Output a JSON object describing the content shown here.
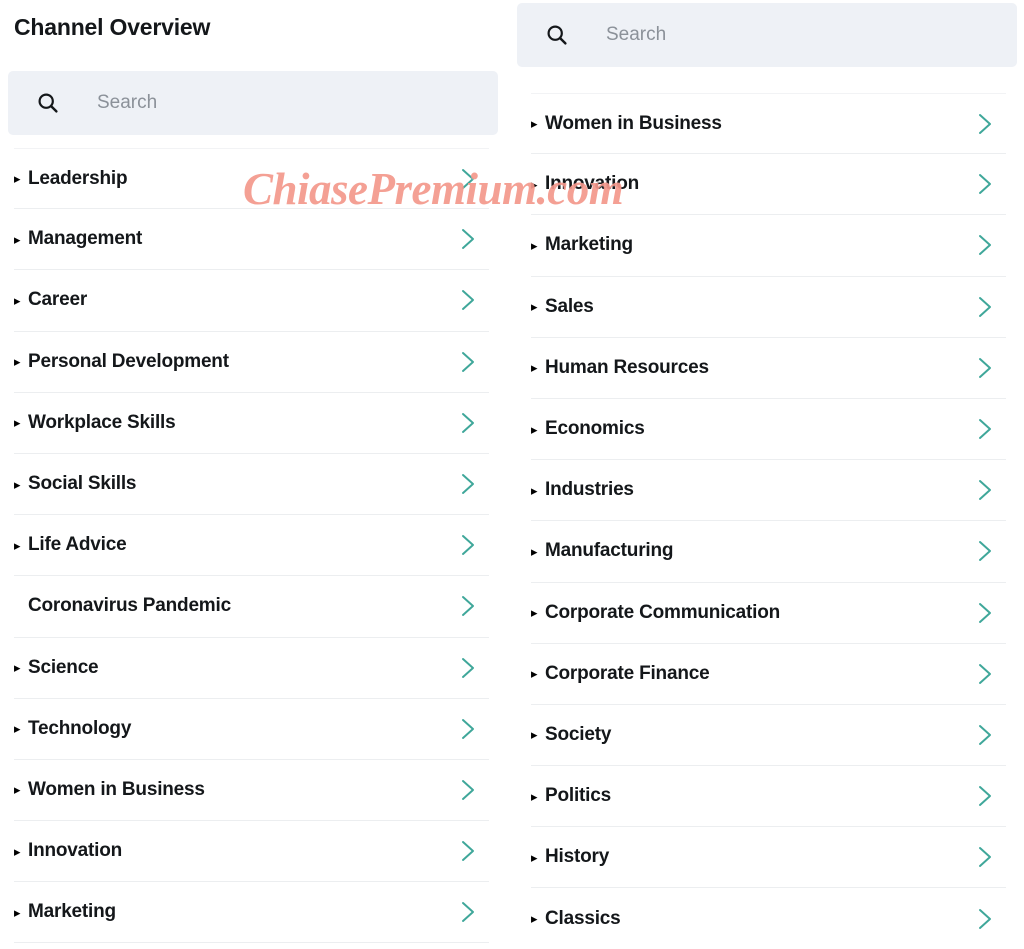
{
  "page": {
    "title": "Channel Overview"
  },
  "watermark": {
    "text": "ChiasePremium.com",
    "color": "#f4988c"
  },
  "colors": {
    "chevron": "#3fa79a",
    "search_background": "#eef1f6",
    "text": "#14171a",
    "placeholder": "#8b9199",
    "divider": "#eceef0"
  },
  "icons": {
    "search": "search-icon",
    "chevron_right": "chevron-right-icon",
    "expand_triangle": "triangle-right-icon"
  },
  "left_panel": {
    "search": {
      "placeholder": "Search",
      "value": ""
    },
    "items": [
      {
        "label": "Leadership",
        "has_marker": true
      },
      {
        "label": "Management",
        "has_marker": true
      },
      {
        "label": "Career",
        "has_marker": true
      },
      {
        "label": "Personal Development",
        "has_marker": true
      },
      {
        "label": "Workplace Skills",
        "has_marker": true
      },
      {
        "label": "Social Skills",
        "has_marker": true
      },
      {
        "label": "Life Advice",
        "has_marker": true
      },
      {
        "label": "Coronavirus Pandemic",
        "has_marker": false
      },
      {
        "label": "Science",
        "has_marker": true
      },
      {
        "label": "Technology",
        "has_marker": true
      },
      {
        "label": "Women in Business",
        "has_marker": true
      },
      {
        "label": "Innovation",
        "has_marker": true
      },
      {
        "label": "Marketing",
        "has_marker": true
      }
    ]
  },
  "right_panel": {
    "search": {
      "placeholder": "Search",
      "value": ""
    },
    "items": [
      {
        "label": "Women in Business",
        "has_marker": true
      },
      {
        "label": "Innovation",
        "has_marker": true
      },
      {
        "label": "Marketing",
        "has_marker": true
      },
      {
        "label": "Sales",
        "has_marker": true
      },
      {
        "label": "Human Resources",
        "has_marker": true
      },
      {
        "label": "Economics",
        "has_marker": true
      },
      {
        "label": "Industries",
        "has_marker": true
      },
      {
        "label": "Manufacturing",
        "has_marker": true
      },
      {
        "label": "Corporate Communication",
        "has_marker": true
      },
      {
        "label": "Corporate Finance",
        "has_marker": true
      },
      {
        "label": "Society",
        "has_marker": true
      },
      {
        "label": "Politics",
        "has_marker": true
      },
      {
        "label": "History",
        "has_marker": true
      },
      {
        "label": "Classics",
        "has_marker": true
      }
    ]
  }
}
